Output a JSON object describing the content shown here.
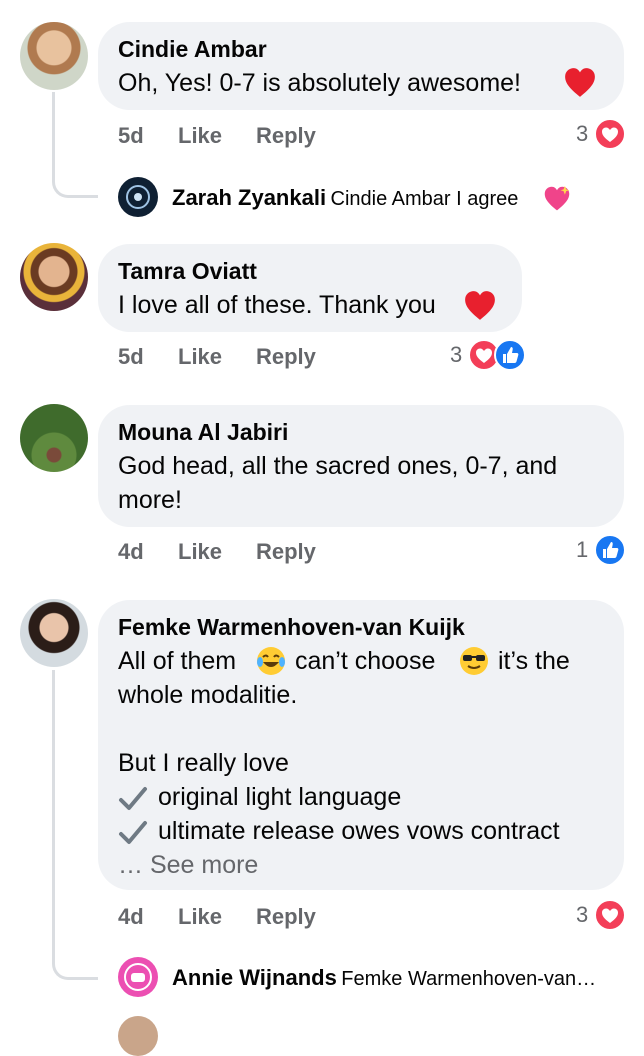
{
  "comments": [
    {
      "author": "Cindie Ambar",
      "text": "Oh, Yes!  0-7 is absolutely awesome!",
      "age": "5d",
      "like": "Like",
      "reply": "Reply",
      "reaction_count": "3",
      "reactions": [
        "heart-reaction"
      ],
      "emoji": "red-heart-emoji",
      "replies": [
        {
          "author": "Zarah Zyankali",
          "text": "Cindie Ambar I agree",
          "emoji": "sparkling-heart-emoji"
        }
      ]
    },
    {
      "author": "Tamra Oviatt",
      "text": "I love all of these. Thank you",
      "age": "5d",
      "like": "Like",
      "reply": "Reply",
      "reaction_count": "3",
      "reactions": [
        "heart-reaction",
        "like-reaction"
      ],
      "emoji": "red-heart-emoji"
    },
    {
      "author": "Mouna Al Jabiri",
      "text_line1": "God head, all the sacred ones, 0-7, and",
      "text_line2": "more!",
      "age": "4d",
      "like": "Like",
      "reply": "Reply",
      "reaction_count": "1",
      "reactions": [
        "like-reaction"
      ]
    },
    {
      "author": "Femke Warmenhoven-van Kuijk",
      "line1_a": "All of them",
      "line1_b": "can’t choose",
      "line1_c": "it’s the",
      "line2": "whole modalitie.",
      "line3": "But I really love",
      "line4": "original light language",
      "line5": "ultimate release owes vows contract",
      "see_more": "… See more",
      "age": "4d",
      "like": "Like",
      "reply": "Reply",
      "reaction_count": "3",
      "reactions": [
        "heart-reaction"
      ],
      "replies": [
        {
          "author": "Annie Wijnands",
          "text": "Femke Warmenhoven-van…"
        }
      ]
    }
  ],
  "colors": {
    "bubble": "#f0f2f5",
    "meta": "#65676b",
    "love": "#f33e58",
    "like": "#1877f2"
  }
}
